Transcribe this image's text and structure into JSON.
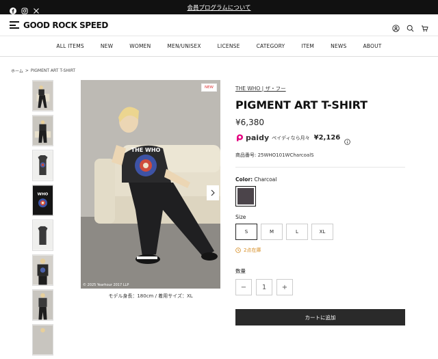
{
  "topbar": {
    "member_link": "会員プログラムについて",
    "social_icons": [
      "facebook-icon",
      "instagram-icon",
      "x-icon"
    ]
  },
  "header": {
    "logo_text": "GOOD ROCK SPEED",
    "icons": [
      "account-icon",
      "search-icon",
      "cart-icon"
    ]
  },
  "nav": {
    "items": [
      "ALL ITEMS",
      "NEW",
      "WOMEN",
      "MEN/UNISEX",
      "LICENSE",
      "CATEGORY",
      "ITEM",
      "NEWS",
      "ABOUT"
    ]
  },
  "breadcrumb": {
    "home": "ホーム",
    "separator": ">",
    "current": "PIGMENT ART T-SHIRT"
  },
  "gallery": {
    "badge": "NEW",
    "copyright": "© 2025 Yearhour 2017 LLP",
    "caption": "モデル身長：180cm / 着用サイズ：XL"
  },
  "product": {
    "brand": "THE WHO | ザ・フー",
    "title": "PIGMENT ART T-SHIRT",
    "price": "¥6,380",
    "paidy_brand": "paidy",
    "paidy_text": "ペイディなら月々",
    "paidy_amount": "¥2,126",
    "sku": "商品番号: 25WHO101WCharcoalS",
    "color_label": "Color:",
    "color_value": "Charcoal",
    "size_label": "Size",
    "sizes": [
      "S",
      "M",
      "L",
      "XL"
    ],
    "selected_size": "S",
    "stock": "2点在庫",
    "qty_label": "数量",
    "qty_value": "1",
    "qty_minus": "−",
    "qty_plus": "+",
    "add_to_cart": "カートに追加"
  },
  "colors": {
    "topbar_bg": "#111111",
    "swatch_charcoal": "#4b444a",
    "stock_orange": "#d58a1e",
    "cart_button": "#2a2a2a",
    "paidy_pink": "#e4007f"
  }
}
